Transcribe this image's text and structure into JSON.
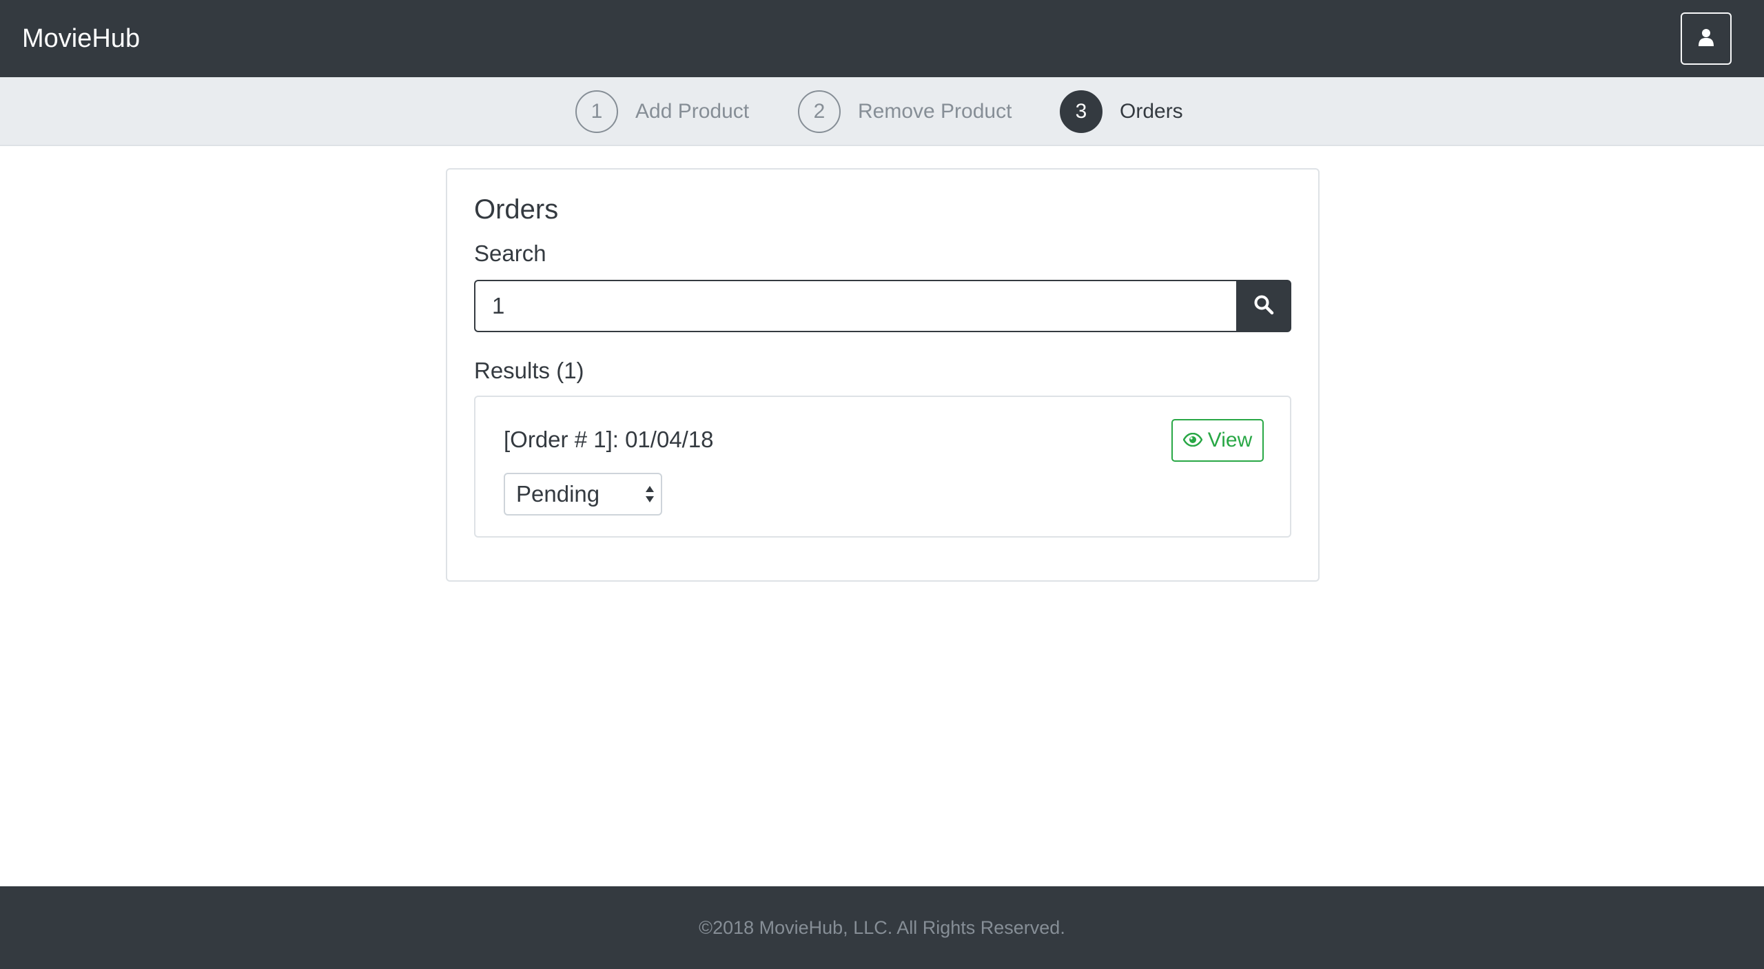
{
  "navbar": {
    "brand": "MovieHub",
    "user_icon": "user-icon"
  },
  "stepper": {
    "steps": [
      {
        "number": "1",
        "label": "Add Product",
        "active": false
      },
      {
        "number": "2",
        "label": "Remove Product",
        "active": false
      },
      {
        "number": "3",
        "label": "Orders",
        "active": true
      }
    ]
  },
  "orders": {
    "title": "Orders",
    "search_label": "Search",
    "search_value": "1",
    "search_icon": "search-icon",
    "results_label": "Results (1)",
    "results": [
      {
        "order_text": "[Order # 1]: 01/04/18",
        "view_label": "View",
        "view_icon": "eye-icon",
        "status": "Pending"
      }
    ]
  },
  "footer": {
    "text": "©2018 MovieHub, LLC. All Rights Reserved."
  },
  "colors": {
    "dark": "#343a40",
    "muted": "#868e96",
    "light_bg": "#e9ecef",
    "success": "#28a745"
  }
}
